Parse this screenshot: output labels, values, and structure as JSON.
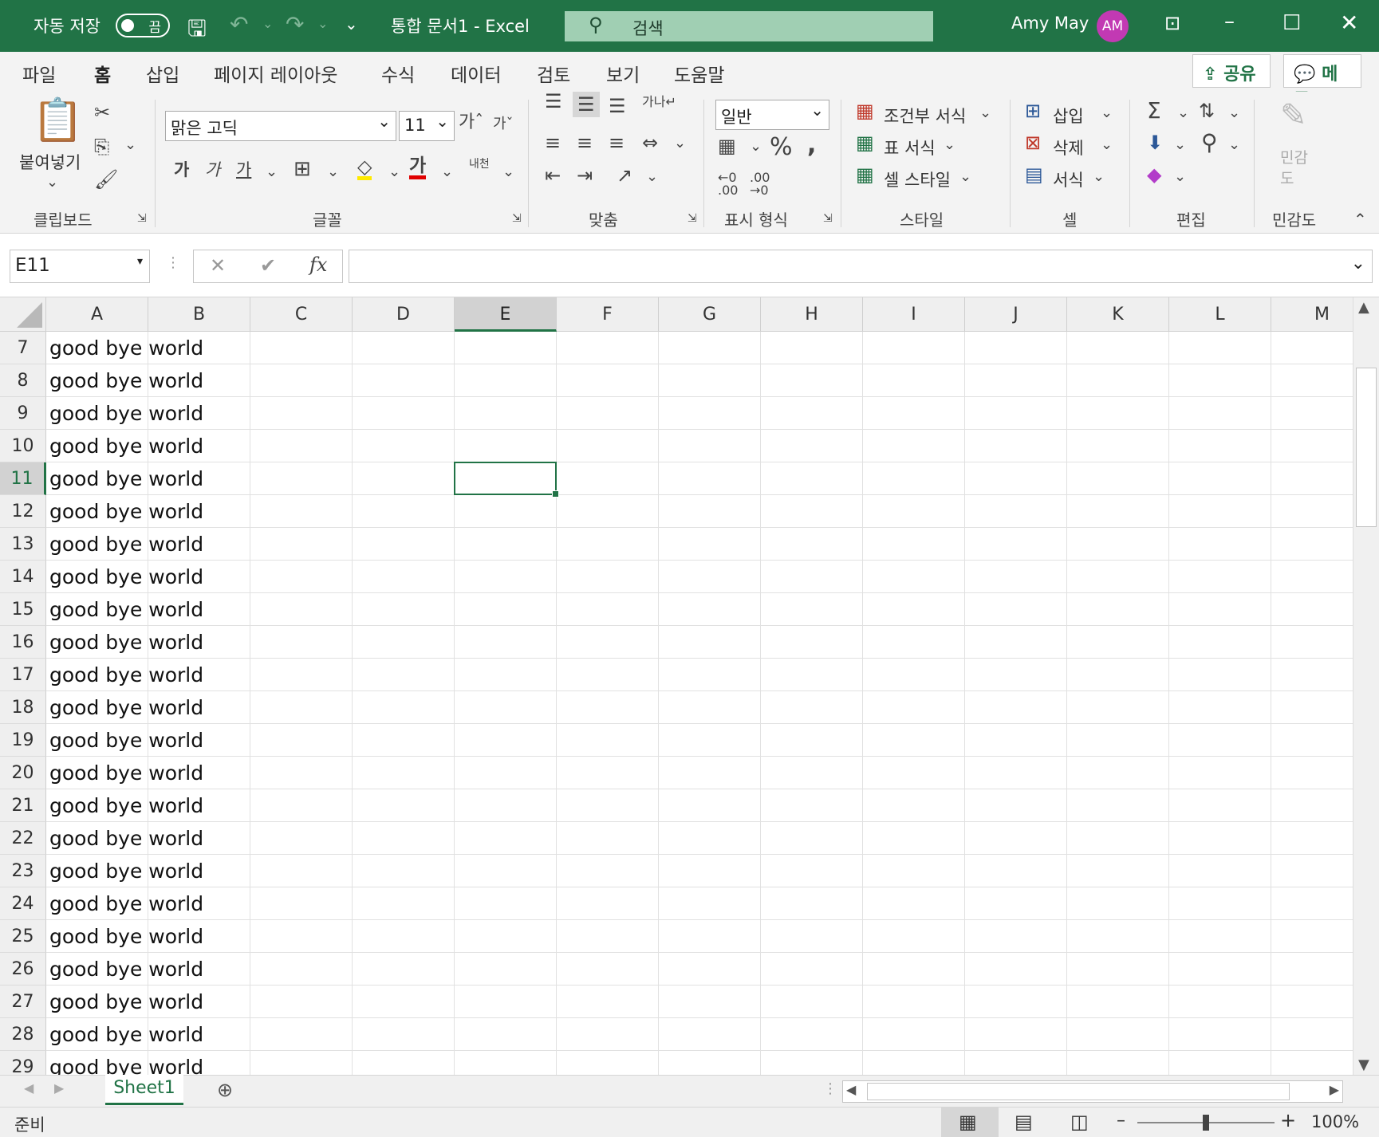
{
  "titlebar": {
    "autosave_label": "자동 저장",
    "autosave_state": "끔",
    "doc_title": "통합 문서1  -  Excel",
    "search_placeholder": "검색",
    "user_name": "Amy May",
    "user_initials": "AM",
    "colors": {
      "brand": "#217346",
      "avatar": "#c239b3"
    }
  },
  "ribbon_tabs": [
    "파일",
    "홈",
    "삽입",
    "페이지 레이아웃",
    "수식",
    "데이터",
    "검토",
    "보기",
    "도움말"
  ],
  "share_label": "공유",
  "comment_label": "메모",
  "ribbon": {
    "paste_label": "붙여넣기",
    "font_name": "맑은 고딕",
    "font_size": "11",
    "number_format": "일반",
    "cond_format": "조건부 서식",
    "table_format": "표 서식",
    "cell_style": "셀 스타일",
    "insert": "삽입",
    "delete": "삭제",
    "format": "서식",
    "sensitivity": "민감도",
    "groups": {
      "clipboard": "클립보드",
      "font": "글꼴",
      "alignment": "맞춤",
      "number": "표시 형식",
      "styles": "스타일",
      "cells": "셀",
      "editing": "편집",
      "sensitivity": "민감도"
    }
  },
  "formula_bar": {
    "name_box": "E11",
    "formula": ""
  },
  "grid": {
    "columns": [
      "A",
      "B",
      "C",
      "D",
      "E",
      "F",
      "G",
      "H",
      "I",
      "J",
      "K",
      "L",
      "M"
    ],
    "selected_column": "E",
    "rows": [
      {
        "num": "7",
        "a": "good bye world"
      },
      {
        "num": "8",
        "a": "good bye world"
      },
      {
        "num": "9",
        "a": "good bye world"
      },
      {
        "num": "10",
        "a": "good bye world"
      },
      {
        "num": "11",
        "a": "good bye world"
      },
      {
        "num": "12",
        "a": "good bye world"
      },
      {
        "num": "13",
        "a": "good bye world"
      },
      {
        "num": "14",
        "a": "good bye world"
      },
      {
        "num": "15",
        "a": "good bye world"
      },
      {
        "num": "16",
        "a": "good bye world"
      },
      {
        "num": "17",
        "a": "good bye world"
      },
      {
        "num": "18",
        "a": "good bye world"
      },
      {
        "num": "19",
        "a": "good bye world"
      },
      {
        "num": "20",
        "a": "good bye world"
      },
      {
        "num": "21",
        "a": "good bye world"
      },
      {
        "num": "22",
        "a": "good bye world"
      },
      {
        "num": "23",
        "a": "good bye world"
      },
      {
        "num": "24",
        "a": "good bye world"
      },
      {
        "num": "25",
        "a": "good bye world"
      },
      {
        "num": "26",
        "a": "good bye world"
      },
      {
        "num": "27",
        "a": "good bye world"
      },
      {
        "num": "28",
        "a": "good bye world"
      },
      {
        "num": "29",
        "a": "good bye world"
      }
    ],
    "selected_row": "11"
  },
  "sheets": [
    "Sheet1"
  ],
  "status": {
    "ready": "준비",
    "zoom": "100%"
  }
}
